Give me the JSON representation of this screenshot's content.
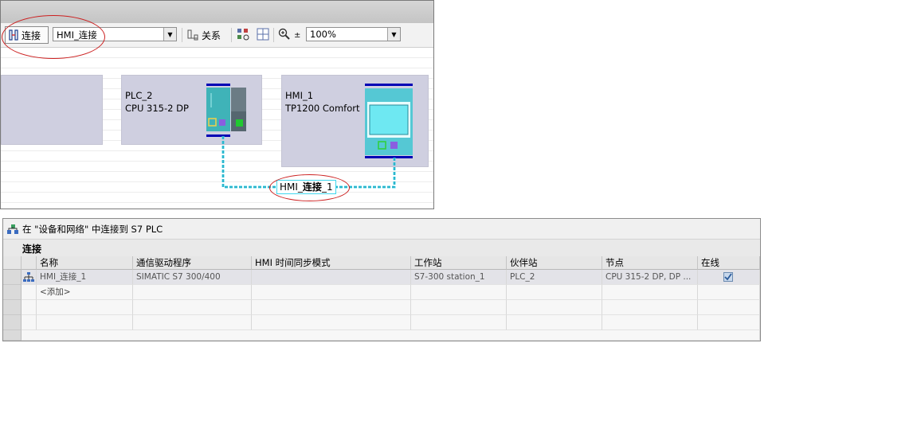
{
  "toolbar": {
    "connect_label": "连接",
    "connection_type": "HMI_连接",
    "relation_label": "关系",
    "zoom_value": "100%"
  },
  "devices": [
    {
      "name": "PLC_2",
      "type": "CPU 315-2 DP"
    },
    {
      "name": "HMI_1",
      "type": "TP1200 Comfort"
    }
  ],
  "connection_label": {
    "prefix": "HMI_",
    "bold": "连接",
    "suffix": "_1"
  },
  "panel": {
    "title": "在 \"设备和网络\" 中连接到 S7 PLC",
    "section": "连接"
  },
  "table": {
    "columns": [
      "名称",
      "通信驱动程序",
      "HMI 时间同步模式",
      "工作站",
      "伙伴站",
      "节点",
      "在线"
    ],
    "rows": [
      {
        "name": "HMI_连接_1",
        "driver": "SIMATIC S7 300/400",
        "sync": "",
        "station": "S7-300 station_1",
        "partner": "PLC_2",
        "node": "CPU 315-2 DP, DP ...",
        "online": true
      }
    ],
    "add_label": "<添加>"
  },
  "colors": {
    "accent_blue": "#0000b4",
    "network_cyan": "#40d8ee",
    "annotation_red": "#cc2020",
    "device_box": "#cfcfe0"
  }
}
